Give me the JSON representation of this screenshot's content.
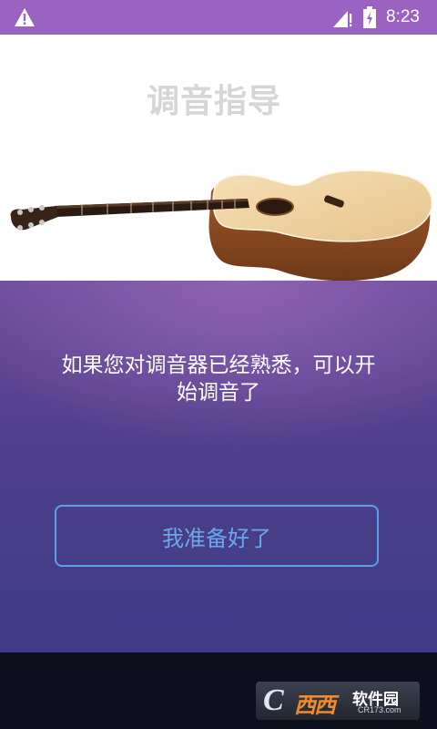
{
  "status_bar": {
    "time": "8:23",
    "icons": [
      "warning-icon",
      "signal-icon",
      "battery-icon"
    ],
    "background": "#9a63c2"
  },
  "header": {
    "title": "调音指导",
    "image": "acoustic-guitar"
  },
  "main": {
    "message": "如果您对调音器已经熟悉，可以开始调音了",
    "button_label": "我准备好了",
    "accent_color": "#5d9ee8"
  },
  "watermark": {
    "logo_letter": "C",
    "logo_mark": "西西",
    "name": "软件园",
    "domain": "CR173.com"
  }
}
